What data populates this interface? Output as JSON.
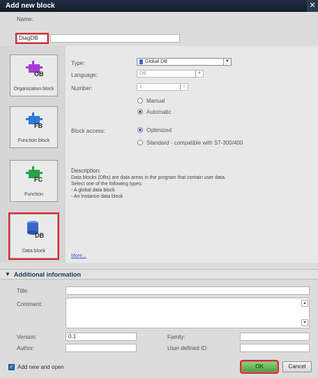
{
  "dialog": {
    "title": "Add new block",
    "close_glyph": "✕"
  },
  "name": {
    "label": "Name:",
    "value": "DiagDB"
  },
  "blocks": [
    {
      "label": "Organization block",
      "code": "OB",
      "color": "#a23bd6"
    },
    {
      "label": "Function block",
      "code": "FB",
      "color": "#2a7ad6"
    },
    {
      "label": "Function",
      "code": "FC",
      "color": "#28a046"
    },
    {
      "label": "Data block",
      "code": "DB",
      "color": "#3867c9"
    }
  ],
  "form": {
    "type_label": "Type:",
    "type_value": "Global DB",
    "language_label": "Language:",
    "language_value": "DB",
    "number_label": "Number:",
    "number_value": "1",
    "manual_label": "Manual",
    "automatic_label": "Automatic",
    "access_label": "Block access:",
    "optimized_label": "Optimized",
    "standard_label": "Standard - compatible with S7-300/400"
  },
  "description": {
    "heading": "Description:",
    "lines": [
      "Data blocks (DBs) are data areas in the program that contain user data.",
      "Select one of the following types:",
      "- A global data block",
      "- An instance data block"
    ],
    "more_link": "More..."
  },
  "additional": {
    "heading": "Additional  information",
    "title_label": "Title:",
    "comment_label": "Comment:",
    "version_label": "Version:",
    "version_value": "0.1",
    "family_label": "Family:",
    "author_label": "Author:",
    "userdef_label": "User-defined ID:"
  },
  "footer": {
    "add_open_label": "Add new and open",
    "ok_label": "OK",
    "cancel_label": "Cancel"
  }
}
